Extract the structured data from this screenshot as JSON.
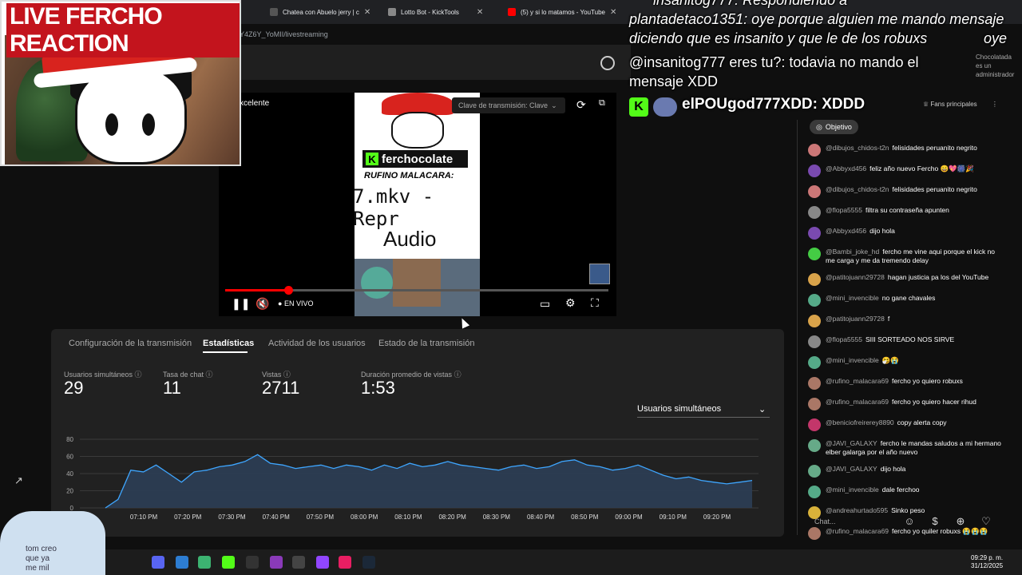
{
  "browser": {
    "tabs": [
      {
        "label": "Chatea con Abuelo jerry | c",
        "close": "✕"
      },
      {
        "label": "Lotto Bot - KickTools",
        "close": "✕"
      },
      {
        "label": "(5) y si lo matamos - YouTube",
        "close": "✕"
      }
    ],
    "url": "Y4Z6Y_YoMII/livestreaming"
  },
  "webcam": {
    "title": "LIVE FERCHO REACTION"
  },
  "player": {
    "quality": "xcelente",
    "stream_key": "Clave de transmisión: Clave",
    "live_label": "EN VIVO",
    "preview": {
      "channel": "ferchocolate",
      "rufino": "RUFINO MALACARA:",
      "file": "7.mkv - Repr",
      "audio": "Audio"
    }
  },
  "tabs": [
    {
      "label": "Configuración de la transmisión"
    },
    {
      "label": "Estadísticas"
    },
    {
      "label": "Actividad de los usuarios"
    },
    {
      "label": "Estado de la transmisión"
    }
  ],
  "metrics": [
    {
      "label": "Usuarios simultáneos",
      "value": "29"
    },
    {
      "label": "Tasa de chat",
      "value": "11"
    },
    {
      "label": "Vistas",
      "value": "2711"
    },
    {
      "label": "Duración promedio de vistas",
      "value": "1:53"
    }
  ],
  "dropdown": {
    "selected": "Usuarios simultáneos"
  },
  "chart_data": {
    "type": "area",
    "title": "",
    "xlabel": "",
    "ylabel": "",
    "ylim": [
      0,
      80
    ],
    "yticks": [
      "0",
      "20",
      "40",
      "60",
      "80"
    ],
    "xticks": [
      "07:10 PM",
      "07:20 PM",
      "07:30 PM",
      "07:40 PM",
      "07:50 PM",
      "08:00 PM",
      "08:10 PM",
      "08:20 PM",
      "08:30 PM",
      "08:40 PM",
      "08:50 PM",
      "09:00 PM",
      "09:10 PM",
      "09:20 PM"
    ],
    "series": [
      {
        "values": [
          0,
          10,
          44,
          42,
          50,
          40,
          30,
          42,
          44,
          48,
          50,
          54,
          62,
          52,
          50,
          46,
          48,
          50,
          46,
          50,
          48,
          44,
          50,
          46,
          52,
          48,
          50,
          54,
          50,
          48,
          46,
          44,
          48,
          50,
          46,
          48,
          54,
          56,
          50,
          48,
          44,
          46,
          50,
          44,
          38,
          34,
          36,
          32,
          30,
          28,
          30,
          32
        ]
      }
    ],
    "color": "#3ea6ff",
    "grid": true
  },
  "overlay": {
    "line1": "insanitog777: Respondiendo a",
    "line2": "plantadetaco1351: oye porque alguien me mando mensaje",
    "line3": "diciendo que es insanito y que le de los robuxs",
    "line3b": "oye",
    "line4": "@insanitog777 eres tu?: todavia no mando el",
    "line5": "mensaje XDD",
    "big": "elPOUgod777XDD: XDDD",
    "badge_name": "Chocolatada",
    "badge_role": "es un administrador"
  },
  "chat": {
    "objetivo": "Objetivo",
    "fans": "Fans principales",
    "placeholder": "Chat...",
    "messages": [
      {
        "user": "@dibujos_chidos-t2n",
        "text": "felisidades peruanito negrito",
        "color": "#c77"
      },
      {
        "user": "@Abbyxd456",
        "text": "feliz año nuevo Fercho 😄💖🎆🎉",
        "color": "#7a4ab0"
      },
      {
        "user": "@dibujos_chidos-t2n",
        "text": "felisidades peruanito negrito",
        "color": "#c77"
      },
      {
        "user": "@flopa5555",
        "text": "filtra su contraseña apunten",
        "color": "#888"
      },
      {
        "user": "@Abbyxd456",
        "text": "dijo hola",
        "color": "#7a4ab0"
      },
      {
        "user": "@Bambi_joke_hd",
        "text": "fercho me vine aqui porque el kick no me carga y me da tremendo delay",
        "color": "#4c4"
      },
      {
        "user": "@patitojuann29728",
        "text": "hagan justicia pa los del YouTube",
        "color": "#d9a34a"
      },
      {
        "user": "@mini_invencible",
        "text": "no gane chavales",
        "color": "#5a8"
      },
      {
        "user": "@patitojuann29728",
        "text": "f",
        "color": "#d9a34a"
      },
      {
        "user": "@flopa5555",
        "text": "SIII SORTEADO NOS SIRVE",
        "color": "#888"
      },
      {
        "user": "@mini_invencible",
        "text": "🤧😭",
        "color": "#5a8"
      },
      {
        "user": "@rufino_malacara69",
        "text": "fercho yo quiero robuxs",
        "color": "#a76"
      },
      {
        "user": "@rufino_malacara69",
        "text": "fercho yo quiero hacer rihud",
        "color": "#a76"
      },
      {
        "user": "@beniciofreirerey8890",
        "text": "copy alerta copy",
        "color": "#c3366a"
      },
      {
        "user": "@JAVI_GALAXY",
        "text": "fercho le mandas saludos a mi hermano elber galarga por el año nuevo",
        "color": "#6a8"
      },
      {
        "user": "@JAVI_GALAXY",
        "text": "dijo hola",
        "color": "#6a8"
      },
      {
        "user": "@mini_invencible",
        "text": "dale ferchoo",
        "color": "#5a8"
      },
      {
        "user": "@andreahurtado595",
        "text": "Sinko peso",
        "color": "#d9b23a"
      },
      {
        "user": "@rufino_malacara69",
        "text": "fercho yo quiler robuxs 😭😭😭",
        "color": "#a76"
      }
    ]
  },
  "taskbar": {
    "time": "09:29 p. m.",
    "date": "31/12/2025"
  },
  "bubble": {
    "line1": "tom creo",
    "line2": "que ya",
    "line3": "me mil"
  }
}
